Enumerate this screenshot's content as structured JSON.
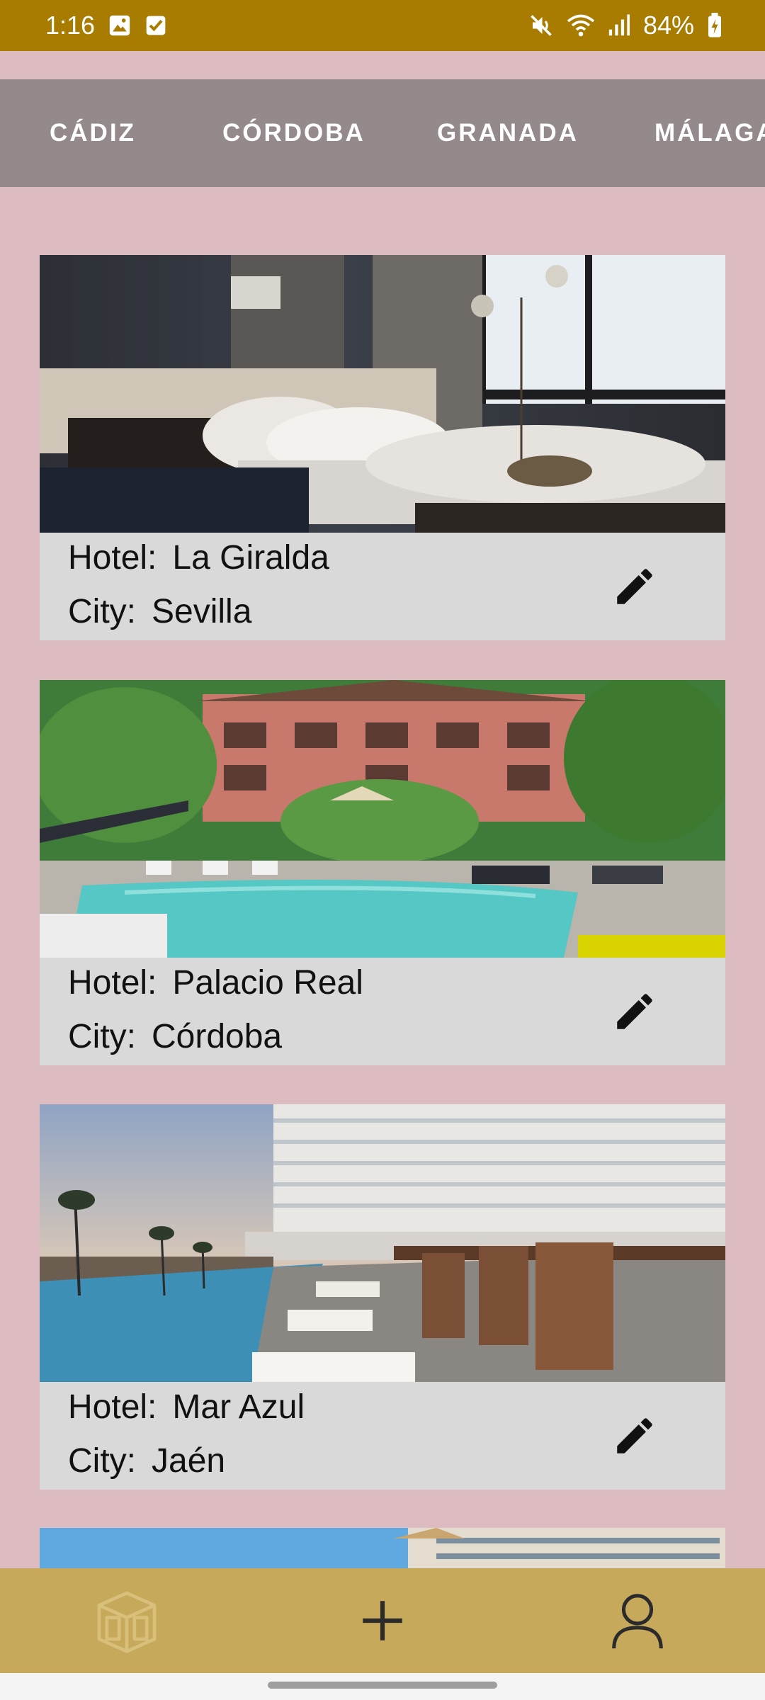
{
  "status_bar": {
    "time": "1:16",
    "battery": "84%",
    "icons": [
      "image-notification-icon",
      "check-notification-icon",
      "mute-icon",
      "wifi-icon",
      "signal-icon",
      "battery-charging-icon"
    ]
  },
  "city_tabs": [
    "CÁDIZ",
    "CÓRDOBA",
    "GRANADA",
    "MÁLAGA"
  ],
  "hotel_cards": [
    {
      "hotel_label": "Hotel:",
      "hotel_name": "La Giralda",
      "city_label": "City:",
      "city_name": "Sevilla",
      "photo": "hotel-bedroom-photo"
    },
    {
      "hotel_label": "Hotel:",
      "hotel_name": "Palacio Real",
      "city_label": "City:",
      "city_name": "Córdoba",
      "photo": "resort-pool-photo"
    },
    {
      "hotel_label": "Hotel:",
      "hotel_name": "Mar Azul",
      "city_label": "City:",
      "city_name": "Jaén",
      "photo": "beachfront-hotel-photo"
    }
  ],
  "bottom_nav": {
    "items": [
      "hotels-icon",
      "add-icon",
      "profile-icon"
    ],
    "colors": {
      "background": "#c6a95a",
      "inactive_icon": "#d8bf7a",
      "active_icon": "#2b2b2b"
    }
  },
  "colors": {
    "status_bar": "#a77c00",
    "page_background": "#dcbcc0",
    "tab_bar": "#958a8b",
    "card_info": "#d9d9d9"
  }
}
